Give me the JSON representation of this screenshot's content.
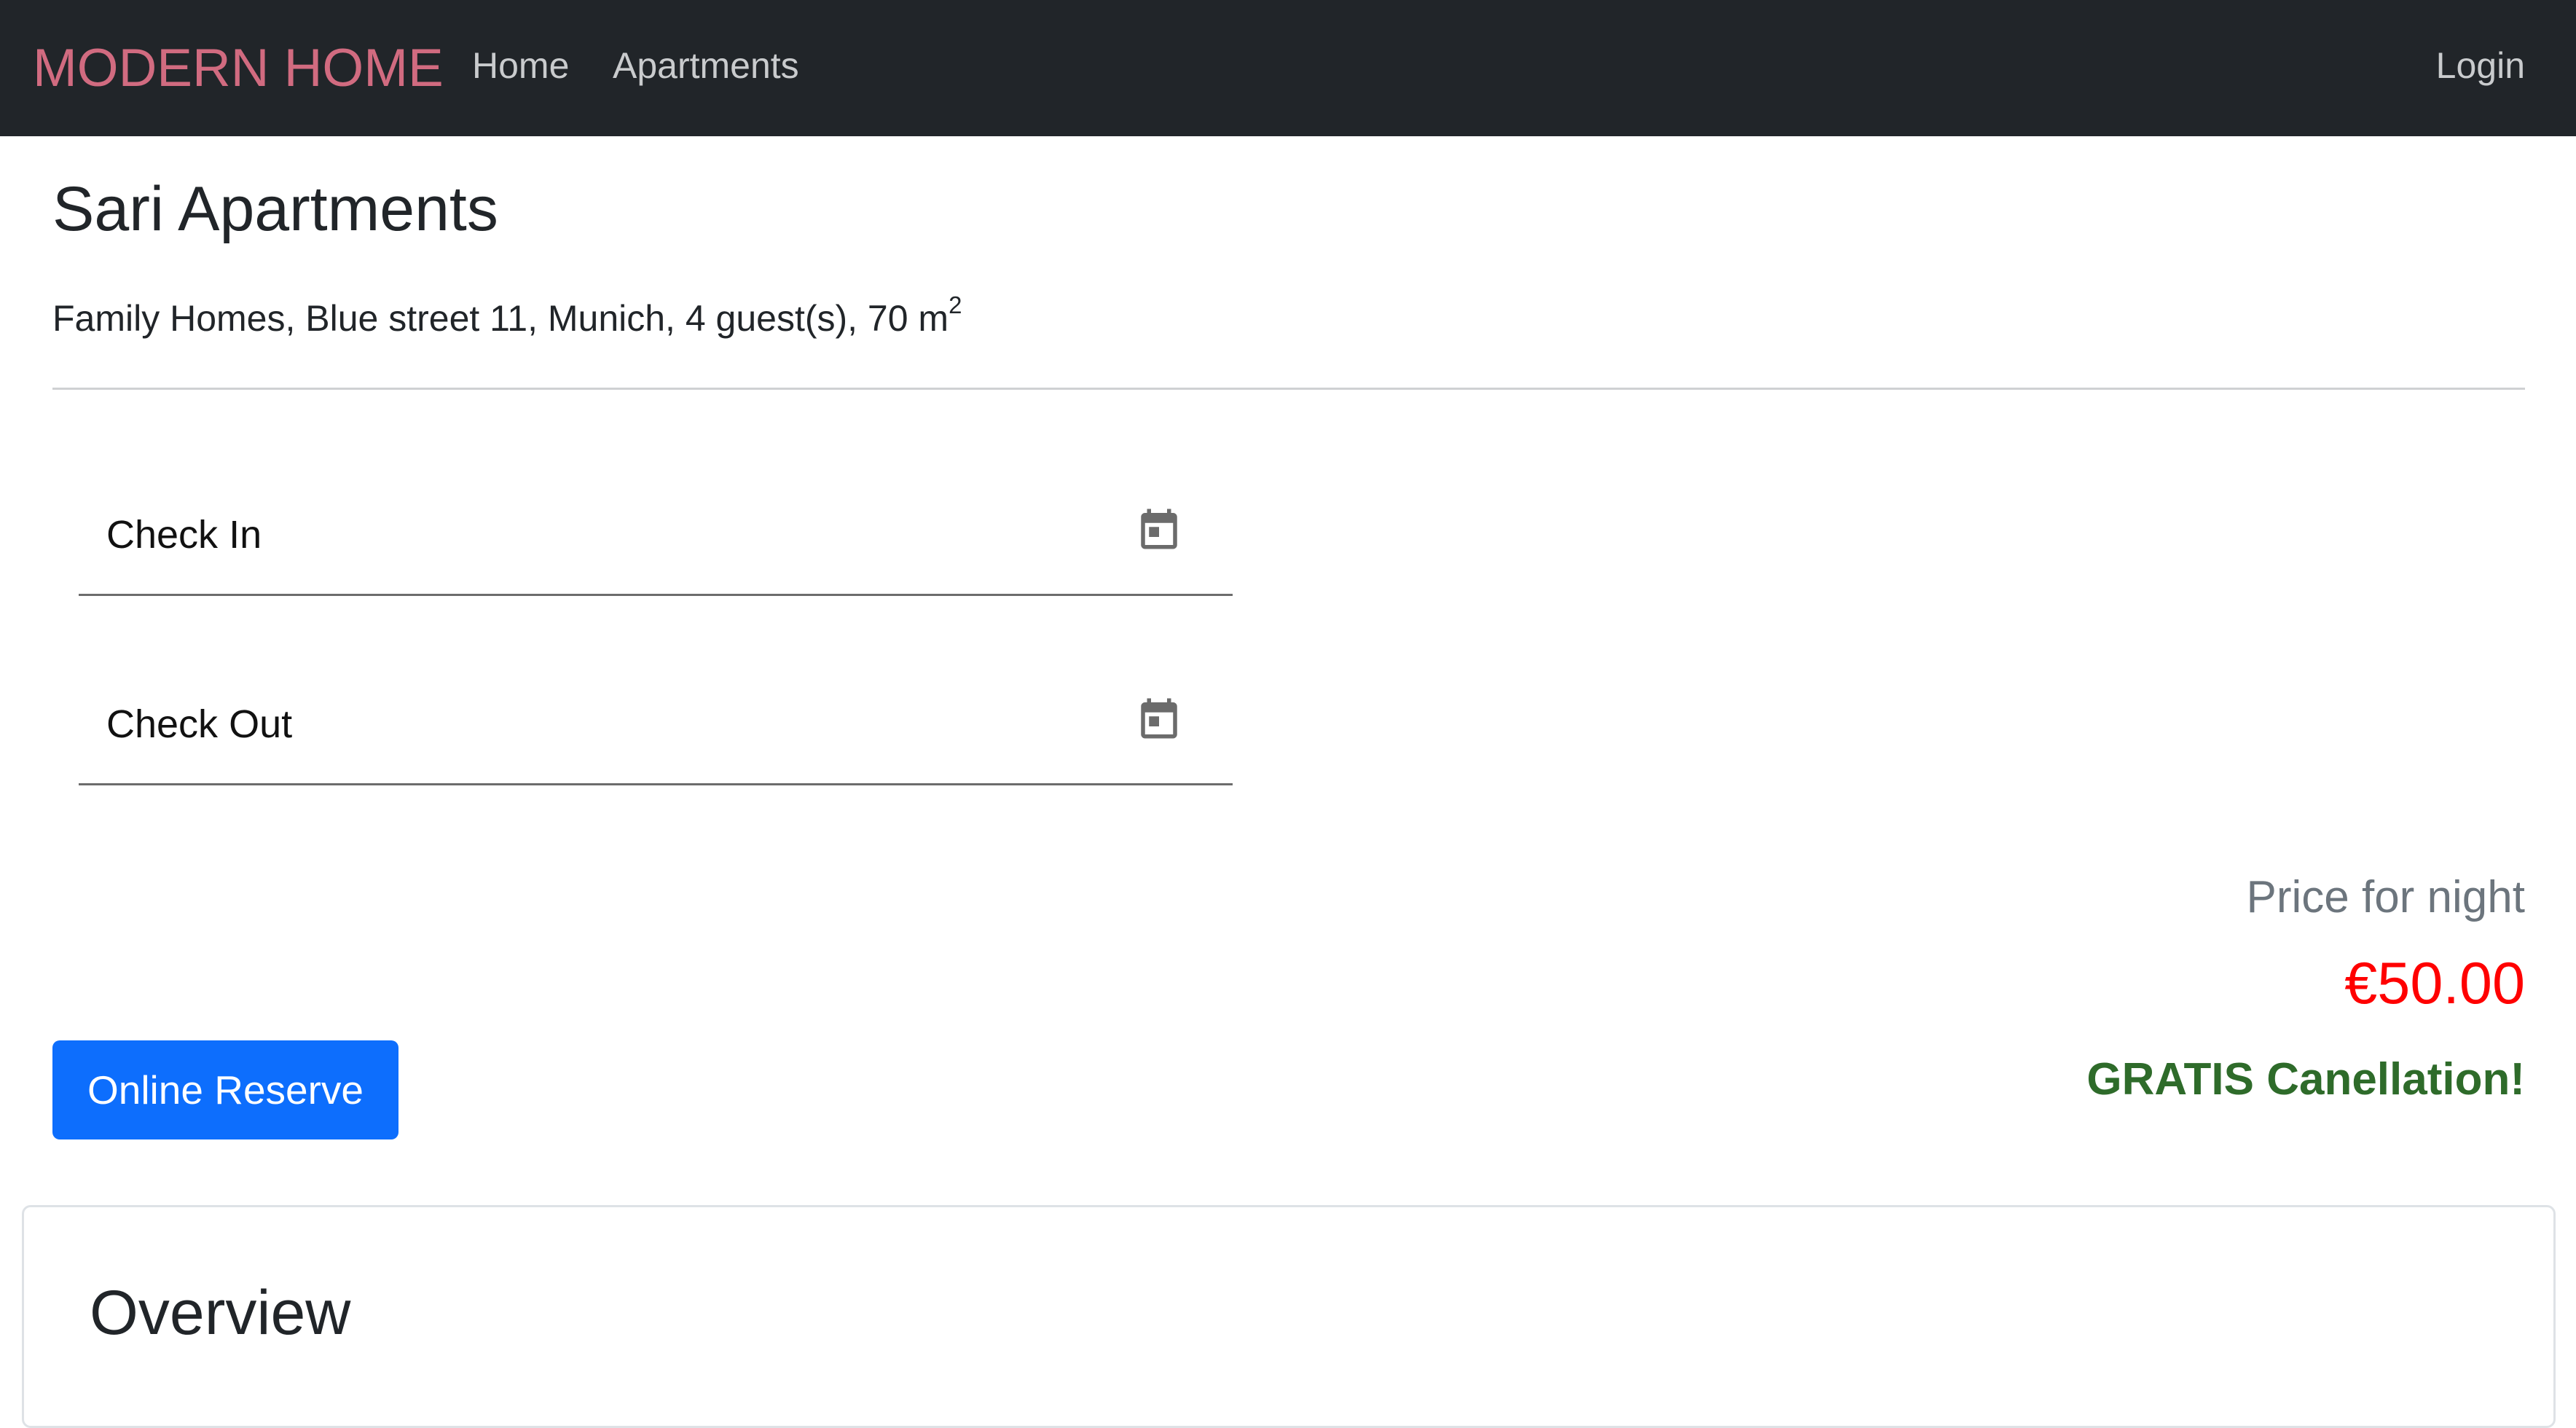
{
  "navbar": {
    "brand": "MODERN HOME",
    "links": [
      "Home",
      "Apartments"
    ],
    "login": "Login"
  },
  "apartment": {
    "title": "Sari Apartments",
    "details": "Family Homes, Blue street 11, Munich, 4 guest(s), 70 m",
    "area_superscript": "2"
  },
  "booking": {
    "check_in_label": "Check In",
    "check_out_label": "Check Out",
    "reserve_button": "Online Reserve"
  },
  "pricing": {
    "label": "Price for night",
    "price": "€50.00",
    "note": "GRATIS Canellation!"
  },
  "overview": {
    "title": "Overview"
  },
  "colors": {
    "navbar_bg": "#212529",
    "brand": "#d16b80",
    "primary_button": "#0d6efd",
    "price": "#ff0000",
    "gratis": "#2e6b2a"
  },
  "icons": [
    "calendar-icon"
  ]
}
